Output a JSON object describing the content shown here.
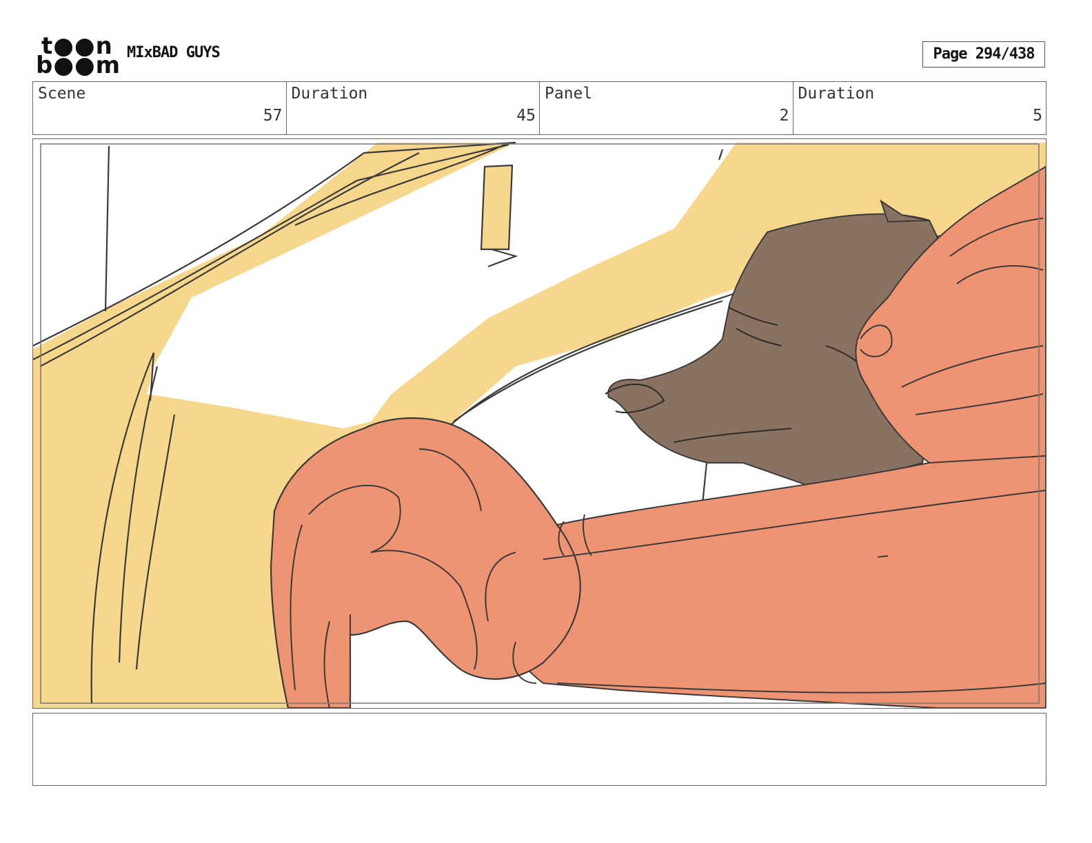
{
  "logo": {
    "line1": "t●●n",
    "line2": "b●●m",
    "name": "toon-boom-logo"
  },
  "project_title": "MIxBAD GUYS",
  "page_label": "Page 294/438",
  "info": [
    {
      "label": "Scene",
      "value": "57"
    },
    {
      "label": "Duration",
      "value": "45"
    },
    {
      "label": "Panel",
      "value": "2"
    },
    {
      "label": "Duration",
      "value": "5"
    }
  ],
  "colors": {
    "car_yellow": "#f6d78c",
    "arm_orange": "#ef9472",
    "wolf_brown": "#8a7262",
    "line": "#3a3a3a"
  }
}
